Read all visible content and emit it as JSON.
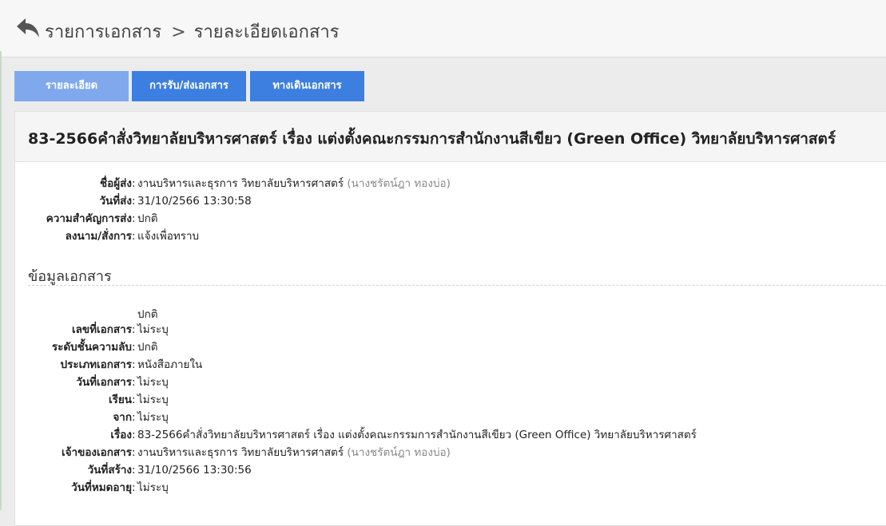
{
  "header": {
    "back_icon": "back-arrow-icon",
    "breadcrumb": [
      "รายการเอกสาร",
      "รายละเอียดเอกสาร"
    ],
    "separator": ">"
  },
  "tabs": [
    {
      "label": "รายละเอียด",
      "active": true
    },
    {
      "label": "การรับ/ส่งเอกสาร",
      "active": false
    },
    {
      "label": "ทางเดินเอกสาร",
      "active": false
    }
  ],
  "document": {
    "title": "83-2566คำสั่งวิทยาลัยบริหารศาสตร์ เรื่อง แต่งตั้งคณะกรรมการสำนักงานสีเขียว (Green Office) วิทยาลัยบริหารศาสตร์"
  },
  "sending": {
    "sender_label": "ชื่อผู้ส่ง",
    "sender_value": "งานบริหารและธุรการ วิทยาลัยบริหารศาสตร์",
    "sender_person": "(นางชรัตน์ฎา ทองบ่อ)",
    "sent_date_label": "วันที่ส่ง",
    "sent_date_value": "31/10/2566 13:30:58",
    "priority_label": "ความสำคัญการส่ง",
    "priority_value": "ปกติ",
    "order_label": "ลงนาม/สั่งการ",
    "order_value": "แจ้งเพื่อทราบ"
  },
  "doc_info": {
    "section_title": "ข้อมูลเอกสาร",
    "first_line": "ปกติ",
    "number_label": "เลขที่เอกสาร",
    "number_value": "ไม่ระบุ",
    "secrecy_label": "ระดับชั้นความลับ",
    "secrecy_value": "ปกติ",
    "type_label": "ประเภทเอกสาร",
    "type_value": "หนังสือภายใน",
    "date_label": "วันที่เอกสาร",
    "date_value": "ไม่ระบุ",
    "to_label": "เรียน",
    "to_value": "ไม่ระบุ",
    "from_label": "จาก",
    "from_value": "ไม่ระบุ",
    "subject_label": "เรื่อง",
    "subject_value": "83-2566คำสั่งวิทยาลัยบริหารศาสตร์ เรื่อง แต่งตั้งคณะกรรมการสำนักงานสีเขียว (Green Office) วิทยาลัยบริหารศาสตร์",
    "owner_label": "เจ้าของเอกสาร",
    "owner_value": "งานบริหารและธุรการ วิทยาลัยบริหารศาสตร์",
    "owner_person": "(นางชรัตน์ฎา ทองบ่อ)",
    "created_label": "วันที่สร้าง",
    "created_value": "31/10/2566 13:30:56",
    "expire_label": "วันที่หมดอายุ",
    "expire_value": "ไม่ระบุ"
  },
  "colors": {
    "tab_active": "#7fa9ec",
    "tab_inactive": "#3d7fe0",
    "muted_text": "#888888"
  }
}
